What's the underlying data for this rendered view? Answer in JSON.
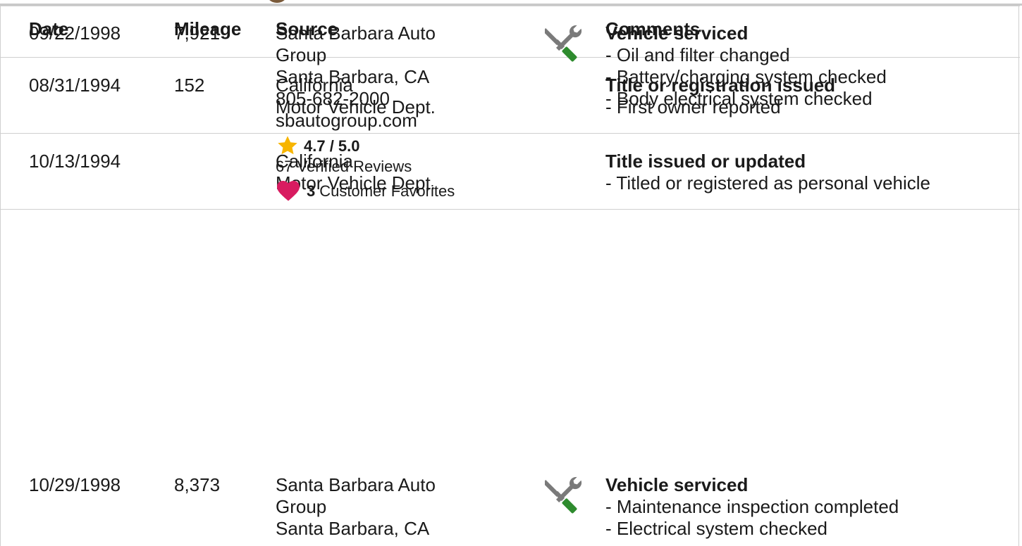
{
  "colors": {
    "star": "#f7b500",
    "heart": "#d81b60",
    "service_icon_gray": "#7a7a7a",
    "service_icon_green": "#2e8b2e",
    "border": "#cfcfcf"
  },
  "header": {
    "date": "Date",
    "mileage": "Mileage",
    "source": "Source",
    "comments": "Comments"
  },
  "rows": [
    {
      "date": "08/31/1994",
      "mileage": "152",
      "source": [
        "California",
        "Motor Vehicle Dept."
      ],
      "icon": "",
      "comment_title": "Title or registration issued",
      "comments": [
        "- First owner reported"
      ]
    },
    {
      "date": "10/13/1994",
      "mileage": "",
      "source": [
        "California",
        "Motor Vehicle Dept."
      ],
      "icon": "",
      "comment_title": "Title issued or updated",
      "comments": [
        "- Titled or registered as personal vehicle"
      ]
    },
    {
      "date": "09/22/1998",
      "mileage": "7,921",
      "source": [
        "Santa Barbara Auto",
        "Group",
        "Santa Barbara, CA",
        "805-682-2000",
        "sbautogroup.com"
      ],
      "rating": "4.7 / 5.0",
      "reviews": "67 Verified Reviews",
      "favorites_count": "3",
      "favorites_label": "Customer Favorites",
      "icon": "wrench-screwdriver-icon",
      "comment_title": "Vehicle serviced",
      "comments": [
        "- Oil and filter changed",
        "- Battery/charging system checked",
        "- Body electrical system checked"
      ]
    },
    {
      "date": "10/29/1998",
      "mileage": "8,373",
      "source": [
        "Santa Barbara Auto",
        "Group",
        "Santa Barbara, CA"
      ],
      "icon": "wrench-screwdriver-icon",
      "comment_title": "Vehicle serviced",
      "comments": [
        "- Maintenance inspection completed",
        "- Electrical system checked"
      ]
    }
  ]
}
